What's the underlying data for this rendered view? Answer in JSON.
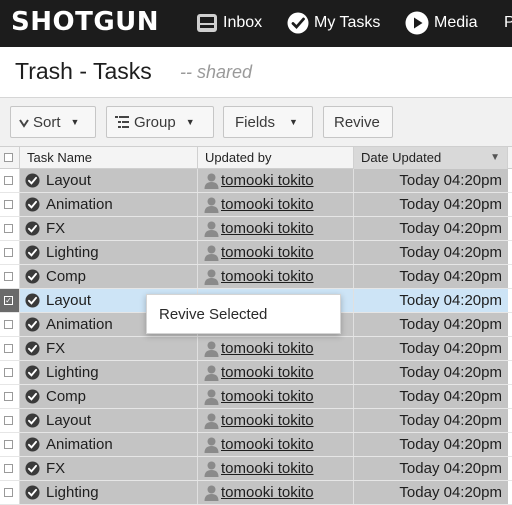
{
  "app": {
    "logo_text": "SHOTGUN"
  },
  "nav": [
    {
      "label": "Inbox",
      "icon": "inbox-icon"
    },
    {
      "label": "My Tasks",
      "icon": "check-circle-icon"
    },
    {
      "label": "Media",
      "icon": "play-circle-icon"
    },
    {
      "label": "P",
      "icon": ""
    }
  ],
  "page": {
    "title": "Trash - Tasks",
    "subtitle": "-- shared"
  },
  "toolbar": {
    "sort_label": "Sort",
    "group_label": "Group",
    "fields_label": "Fields",
    "revive_label": "Revive"
  },
  "table": {
    "columns": [
      "Task Name",
      "Updated by",
      "Date Updated"
    ],
    "sorted_column": "Date Updated",
    "rows": [
      {
        "task": "Layout",
        "user": "tomooki tokito",
        "date": "Today 04:20pm",
        "selected": false
      },
      {
        "task": "Animation",
        "user": "tomooki tokito",
        "date": "Today 04:20pm",
        "selected": false
      },
      {
        "task": "FX",
        "user": "tomooki tokito",
        "date": "Today 04:20pm",
        "selected": false
      },
      {
        "task": "Lighting",
        "user": "tomooki tokito",
        "date": "Today 04:20pm",
        "selected": false
      },
      {
        "task": "Comp",
        "user": "tomooki tokito",
        "date": "Today 04:20pm",
        "selected": false
      },
      {
        "task": "Layout",
        "user": "",
        "date": "Today 04:20pm",
        "selected": true
      },
      {
        "task": "Animation",
        "user": "",
        "date": "Today 04:20pm",
        "selected": false
      },
      {
        "task": "FX",
        "user": "tomooki tokito",
        "date": "Today 04:20pm",
        "selected": false
      },
      {
        "task": "Lighting",
        "user": "tomooki tokito",
        "date": "Today 04:20pm",
        "selected": false
      },
      {
        "task": "Comp",
        "user": "tomooki tokito",
        "date": "Today 04:20pm",
        "selected": false
      },
      {
        "task": "Layout",
        "user": "tomooki tokito",
        "date": "Today 04:20pm",
        "selected": false
      },
      {
        "task": "Animation",
        "user": "tomooki tokito",
        "date": "Today 04:20pm",
        "selected": false
      },
      {
        "task": "FX",
        "user": "tomooki tokito",
        "date": "Today 04:20pm",
        "selected": false
      },
      {
        "task": "Lighting",
        "user": "tomooki tokito",
        "date": "Today 04:20pm",
        "selected": false
      }
    ]
  },
  "context_menu": {
    "items": [
      "Revive Selected"
    ]
  },
  "colors": {
    "topbar": "#1c1c1c",
    "row_bg": "#c4c4c4",
    "selected_row_bg": "#cde4f6",
    "status_icon": "#3a3a3a"
  }
}
